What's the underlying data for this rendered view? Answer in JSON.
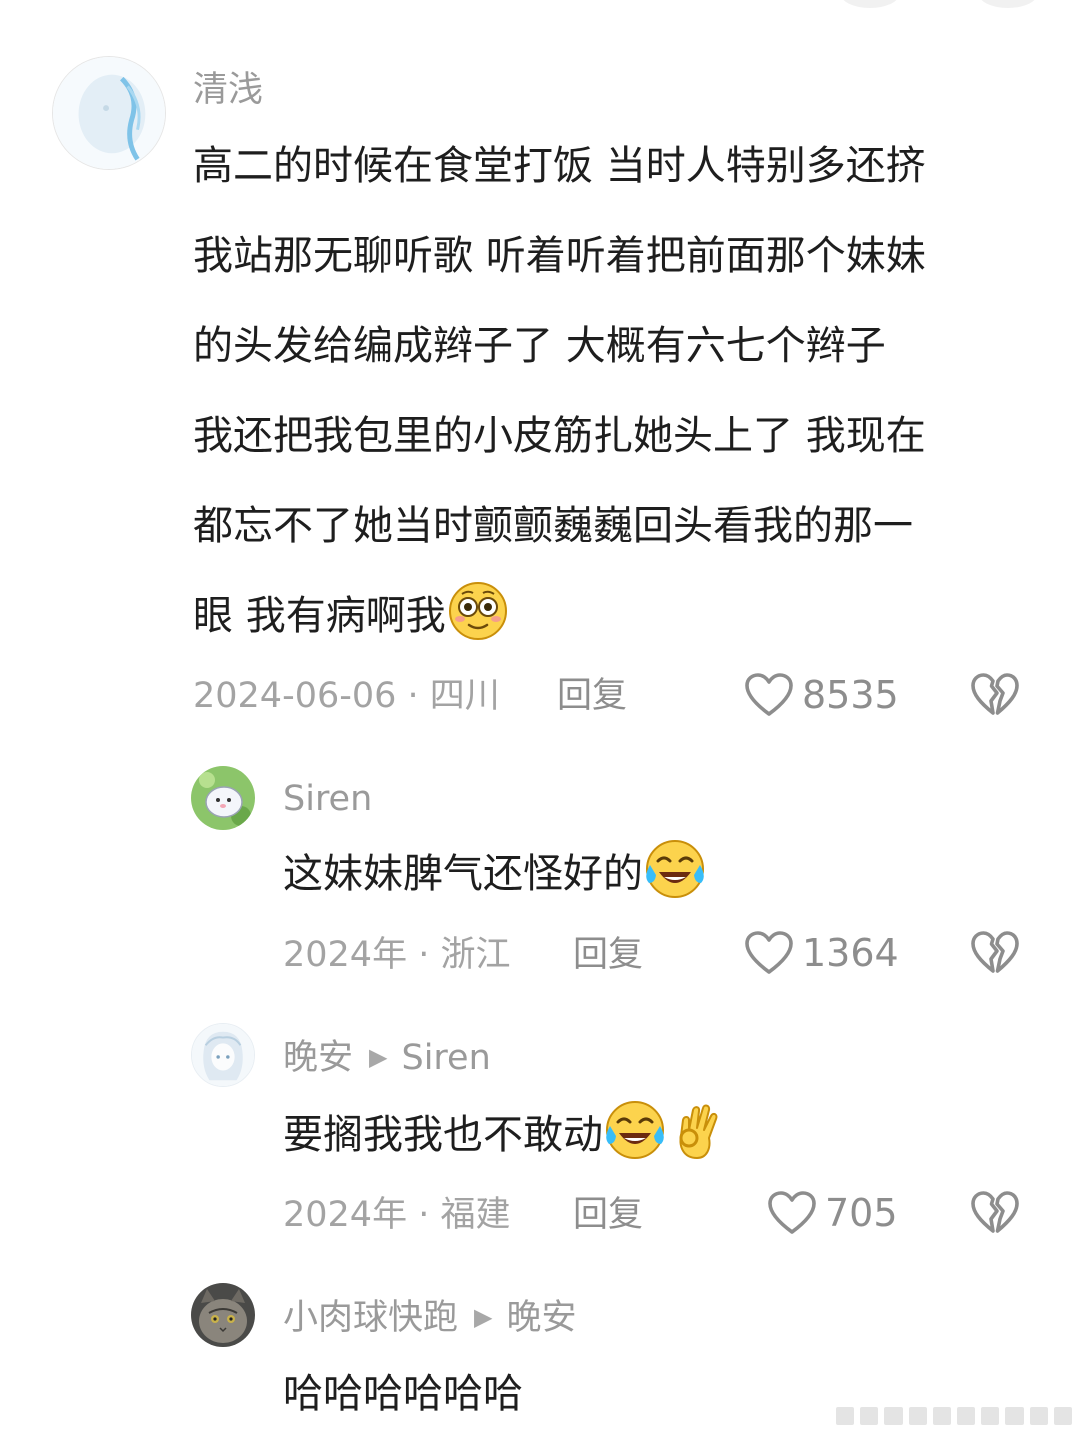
{
  "comments": [
    {
      "user": "清浅",
      "lines": [
        "高二的时候在食堂打饭 当时人特别多还挤",
        "我站那无聊听歌 听着听着把前面那个妹妹",
        "的头发给编成辫子了  大概有六七个辫子",
        "我还把我包里的小皮筋扎她头上了 我现在",
        "都忘不了她当时颤颤巍巍回头看我的那一",
        "眼 我有病啊我"
      ],
      "emoji": [
        "flushed-face"
      ],
      "meta": "2024-06-06 · 四川",
      "reply": "回复",
      "likes": "8535"
    },
    {
      "user": "Siren",
      "text": "这妹妹脾气还怪好的",
      "emoji": [
        "tears-of-joy"
      ],
      "meta": "2024年 · 浙江",
      "reply": "回复",
      "likes": "1364"
    },
    {
      "user": "晚安",
      "reply_to": "Siren",
      "text": "要搁我我也不敢动",
      "emoji": [
        "tears-of-joy",
        "ok-hand"
      ],
      "meta": "2024年 · 福建",
      "reply": "回复",
      "likes": "705"
    },
    {
      "user": "小肉球快跑",
      "reply_to": "晚安",
      "text": "哈哈哈哈哈哈"
    }
  ],
  "colors": {
    "meta_gray": "#a3a3a3",
    "text": "#1e1e1e",
    "icon_gray": "#8d8d8d"
  }
}
